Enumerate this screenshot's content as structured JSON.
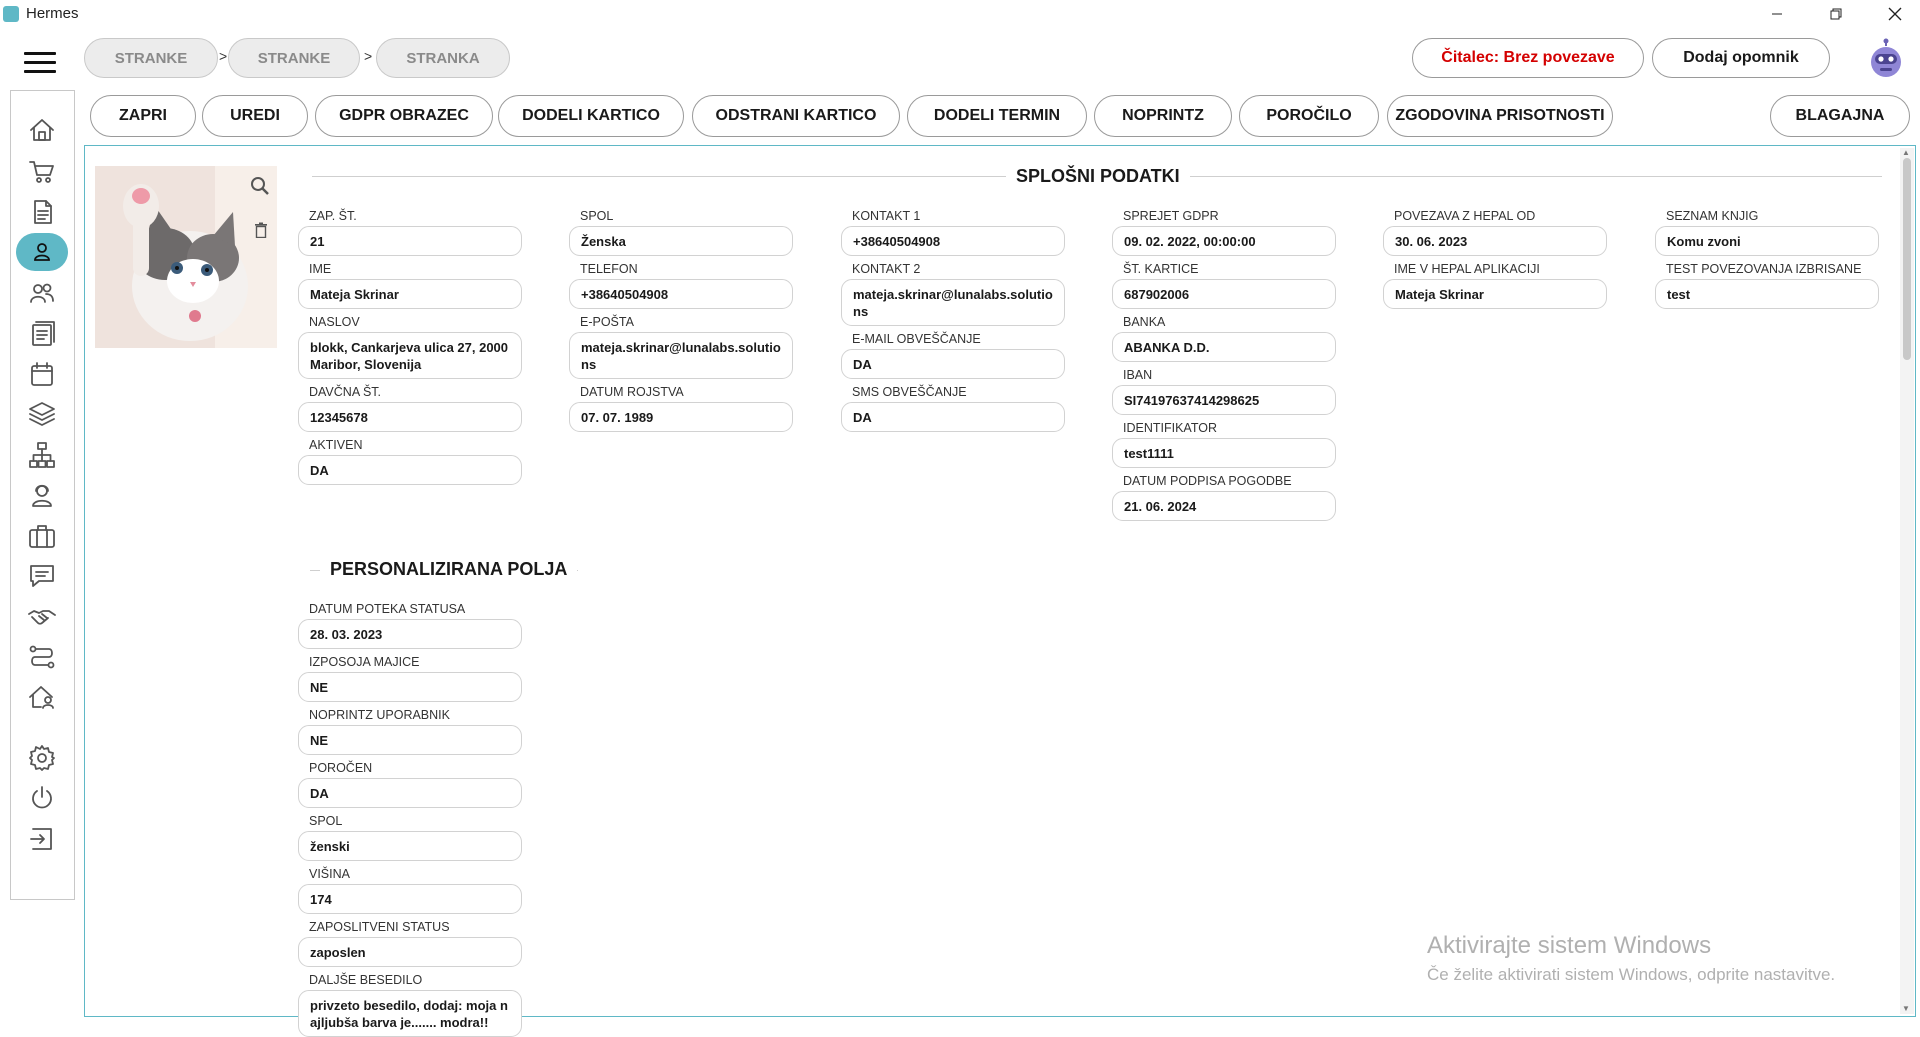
{
  "window": {
    "title": "Hermes"
  },
  "breadcrumbs": [
    "STRANKE",
    "STRANKE",
    "STRANKA"
  ],
  "breadcrumb_sep": ">",
  "header": {
    "reader_status": "Čitalec: Brez povezave",
    "add_reminder": "Dodaj opomnik"
  },
  "actions": [
    "ZAPRI",
    "UREDI",
    "GDPR OBRAZEC",
    "DODELI KARTICO",
    "ODSTRANI KARTICO",
    "DODELI TERMIN",
    "NOPRINTZ",
    "POROČILO",
    "ZGODOVINA PRISOTNOSTI",
    "BLAGAJNA"
  ],
  "sections": {
    "general": "SPLOŠNI PODATKI",
    "custom": "PERSONALIZIRANA POLJA"
  },
  "general_fields": [
    [
      {
        "label": "ZAP. ŠT.",
        "value": "21"
      },
      {
        "label": "IME",
        "value": "Mateja Skrinar"
      },
      {
        "label": "NASLOV",
        "value": "blokk, Cankarjeva ulica 27, 2000 Maribor, Slovenija"
      },
      {
        "label": "DAVČNA ŠT.",
        "value": "12345678"
      },
      {
        "label": "AKTIVEN",
        "value": "DA"
      }
    ],
    [
      {
        "label": "SPOL",
        "value": "Ženska"
      },
      {
        "label": "TELEFON",
        "value": "+38640504908"
      },
      {
        "label": "E-POŠTA",
        "value": "mateja.skrinar@lunalabs.solutions"
      },
      {
        "label": "DATUM ROJSTVA",
        "value": "07. 07. 1989"
      }
    ],
    [
      {
        "label": "KONTAKT 1",
        "value": "+38640504908"
      },
      {
        "label": "KONTAKT 2",
        "value": "mateja.skrinar@lunalabs.solutions"
      },
      {
        "label": "E-MAIL OBVEŠČANJE",
        "value": "DA"
      },
      {
        "label": "SMS OBVEŠČANJE",
        "value": "DA"
      }
    ],
    [
      {
        "label": "SPREJET GDPR",
        "value": "09. 02. 2022, 00:00:00"
      },
      {
        "label": "ŠT. KARTICE",
        "value": "687902006"
      },
      {
        "label": "BANKA",
        "value": "ABANKA D.D."
      },
      {
        "label": "IBAN",
        "value": "SI74197637414298625"
      },
      {
        "label": "IDENTIFIKATOR",
        "value": "test1111"
      },
      {
        "label": "DATUM PODPISA POGODBE",
        "value": "21. 06. 2024"
      }
    ],
    [
      {
        "label": "POVEZAVA Z HEPAL OD",
        "value": "30. 06. 2023"
      },
      {
        "label": "IME V HEPAL APLIKACIJI",
        "value": "Mateja Skrinar"
      }
    ],
    [
      {
        "label": "SEZNAM KNJIG",
        "value": "Komu zvoni"
      },
      {
        "label": "TEST POVEZOVANJA IZBRISANE",
        "value": "test"
      }
    ]
  ],
  "custom_fields": [
    {
      "label": "DATUM POTEKA STATUSA",
      "value": "28. 03. 2023"
    },
    {
      "label": "IZPOSOJA MAJICE",
      "value": "NE"
    },
    {
      "label": "NOPRINTZ UPORABNIK",
      "value": "NE"
    },
    {
      "label": "POROČEN",
      "value": "DA"
    },
    {
      "label": "SPOL",
      "value": "ženski"
    },
    {
      "label": "VIŠINA",
      "value": "174"
    },
    {
      "label": "ZAPOSLITVENI STATUS",
      "value": "zaposlen"
    },
    {
      "label": "DALJŠE BESEDILO",
      "value": "privzeto besedilo, dodaj: moja najljubša barva je....... modra!!"
    }
  ],
  "sidebar": {
    "items": [
      "home-icon",
      "cart-icon",
      "document-icon",
      "user-icon",
      "users-icon",
      "list-icon",
      "calendar-icon",
      "layers-icon",
      "hierarchy-icon",
      "support-agent-icon",
      "briefcase-icon",
      "chat-icon",
      "handshake-icon",
      "route-icon",
      "house-user-icon",
      "settings-icon",
      "power-icon",
      "logout-icon"
    ],
    "active": 3
  },
  "watermark": {
    "title": "Aktivirajte sistem Windows",
    "subtitle": "Če želite aktivirati sistem Windows, odprite nastavitve."
  },
  "colors": {
    "accent": "#5fb8c6",
    "danger": "#d40000"
  }
}
